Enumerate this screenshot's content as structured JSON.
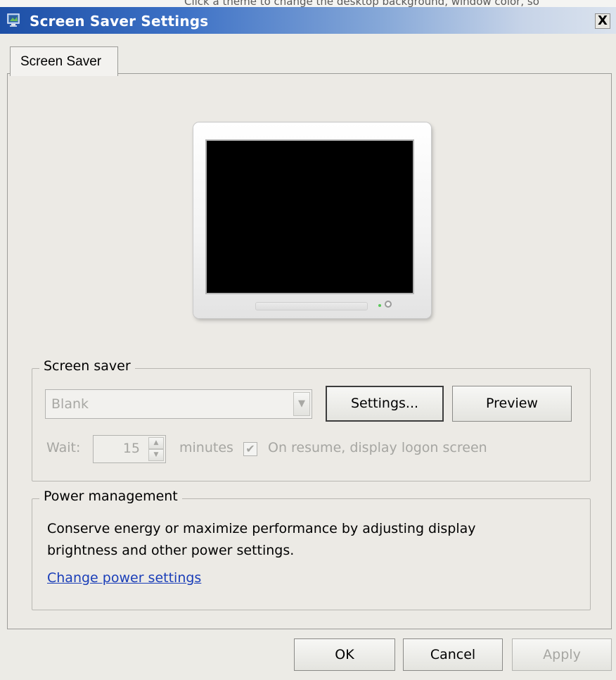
{
  "background_caption": "Click a theme to change the desktop background, window color, so",
  "window": {
    "title": "Screen Saver Settings",
    "close_label": "X"
  },
  "tabs": [
    {
      "label": "Screen Saver",
      "selected": true
    }
  ],
  "screen_saver": {
    "group_label": "Screen saver",
    "selected_value": "Blank",
    "settings_button": "Settings...",
    "preview_button": "Preview",
    "wait_label": "Wait:",
    "wait_value": "15",
    "minutes_label": "minutes",
    "resume_checkbox_label": "On resume, display logon screen",
    "resume_checked": true,
    "controls_disabled": true
  },
  "power_management": {
    "group_label": "Power management",
    "description": "Conserve energy or maximize performance by adjusting display brightness and other power settings.",
    "link_text": "Change power settings"
  },
  "dialog_buttons": {
    "ok": "OK",
    "cancel": "Cancel",
    "apply": "Apply",
    "apply_disabled": true
  },
  "colors": {
    "titlebar_start": "#1d4fa6",
    "dialog_background": "#ecebe6",
    "link": "#1a3eb8",
    "disabled_text": "#a6a6a2"
  },
  "icons": {
    "title_icon": "screen-saver-app-icon",
    "close": "close-icon",
    "combo_arrow": "chevron-down-icon",
    "spin_up": "spin-up-icon",
    "spin_down": "spin-down-icon",
    "check": "check-icon"
  }
}
